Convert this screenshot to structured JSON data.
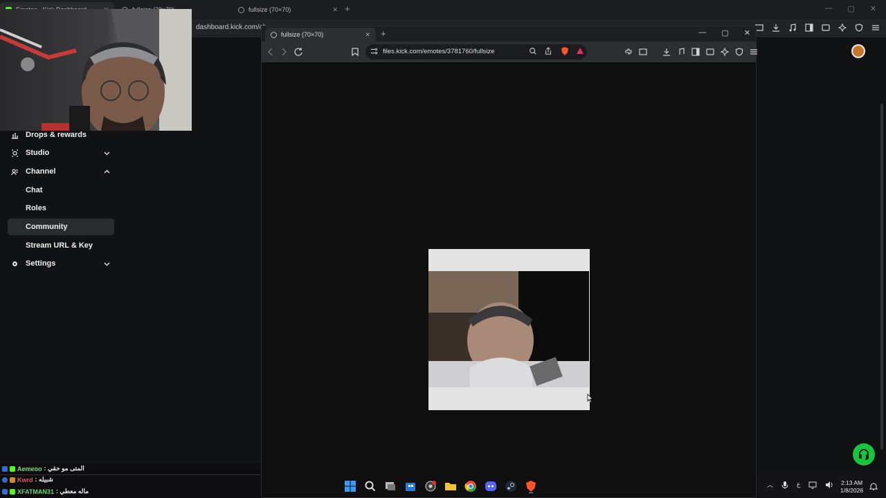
{
  "back_browser": {
    "tabs": [
      {
        "title": "Emotes - Kick Dashboard"
      },
      {
        "title": "fullsize (70×70)"
      },
      {
        "title": "fullsize (70×70)"
      }
    ],
    "url": "dashboard.kick.com/ch"
  },
  "sidebar": {
    "items": [
      {
        "label": "Drops & rewards",
        "icon": "gift-icon"
      },
      {
        "label": "Studio",
        "icon": "studio-icon",
        "chevron": "down"
      },
      {
        "label": "Channel",
        "icon": "channel-icon",
        "chevron": "up"
      },
      {
        "label": "Chat"
      },
      {
        "label": "Roles"
      },
      {
        "label": "Community",
        "active": true
      },
      {
        "label": "Stream URL & Key"
      },
      {
        "label": "Settings",
        "icon": "gear-icon",
        "chevron": "down"
      }
    ]
  },
  "front_browser": {
    "tab_title": "fullsize (70×70)",
    "url": "files.kick.com/emotes/3781760/fullsize"
  },
  "chat": {
    "messages": [
      {
        "user": "Aemeoo",
        "text": ": المتى مو حقي",
        "color": "#7fe07a"
      },
      {
        "user": "Kwrd",
        "text": ": شبيله",
        "color": "#e05a5a"
      },
      {
        "user": "XFATMAN31",
        "text": ": ماله معطي",
        "color": "#6fd36f"
      }
    ]
  },
  "taskbar": {
    "time": "2:13 AM",
    "date": "1/8/2026",
    "lang": "ع"
  },
  "colors": {
    "accent": "#53fc18",
    "support": "#18c43c",
    "background": "#0e0e10"
  }
}
